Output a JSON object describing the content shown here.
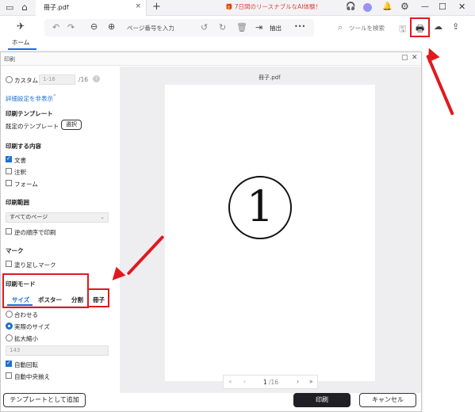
{
  "titlebar": {
    "tab_title": "冊子.pdf",
    "promo": "7日間のリースナブルなAI体験！",
    "close_tab": "×",
    "new_tab": "+",
    "minimize": "—",
    "maximize": "☐",
    "close": "✕"
  },
  "toolbar": {
    "home_label": "ホーム",
    "page_input_placeholder": "ページ番号を入力",
    "extract_label": "抽出",
    "more": "•••",
    "tool_search_placeholder": "ツールを検索"
  },
  "dialog": {
    "title": "印刷",
    "custom_label": "カスタム",
    "custom_placeholder": "1-16",
    "custom_total": "/16",
    "help": "?",
    "details_toggle": "詳細設定を非表示",
    "template_heading": "印刷テンプレート",
    "template_label": "既定のテンプレート",
    "template_select_button": "選択",
    "content_heading": "印刷する内容",
    "content_items": [
      "文書",
      "注釈",
      "フォーム"
    ],
    "range_heading": "印刷範囲",
    "range_select": "すべてのページ",
    "reverse_label": "逆の順序で印刷",
    "mark_heading": "マーク",
    "bleed_label": "塗り足しマーク",
    "mode_heading": "印刷モード",
    "mode_tabs": [
      "サイズ",
      "ポスター",
      "分割",
      "冊子"
    ],
    "size_options": [
      "合わせる",
      "実際のサイズ",
      "拡大縮小"
    ],
    "scale_value": "143",
    "auto_rotate": "自動回転",
    "auto_center": "自動中央揃え",
    "add_template_button": "テンプレートとして追加",
    "print_button": "印刷",
    "cancel_button": "キャンセル"
  },
  "preview": {
    "filename": "冊子.pdf",
    "page_glyph": "①",
    "current_page": "1",
    "total_pages": "/16",
    "first": "«",
    "prev": "‹",
    "next": "›",
    "last": "»"
  },
  "colors": {
    "accent": "#1d6fd6",
    "annotation_red": "#e0191e",
    "print_button_bg": "#1f1f24"
  }
}
